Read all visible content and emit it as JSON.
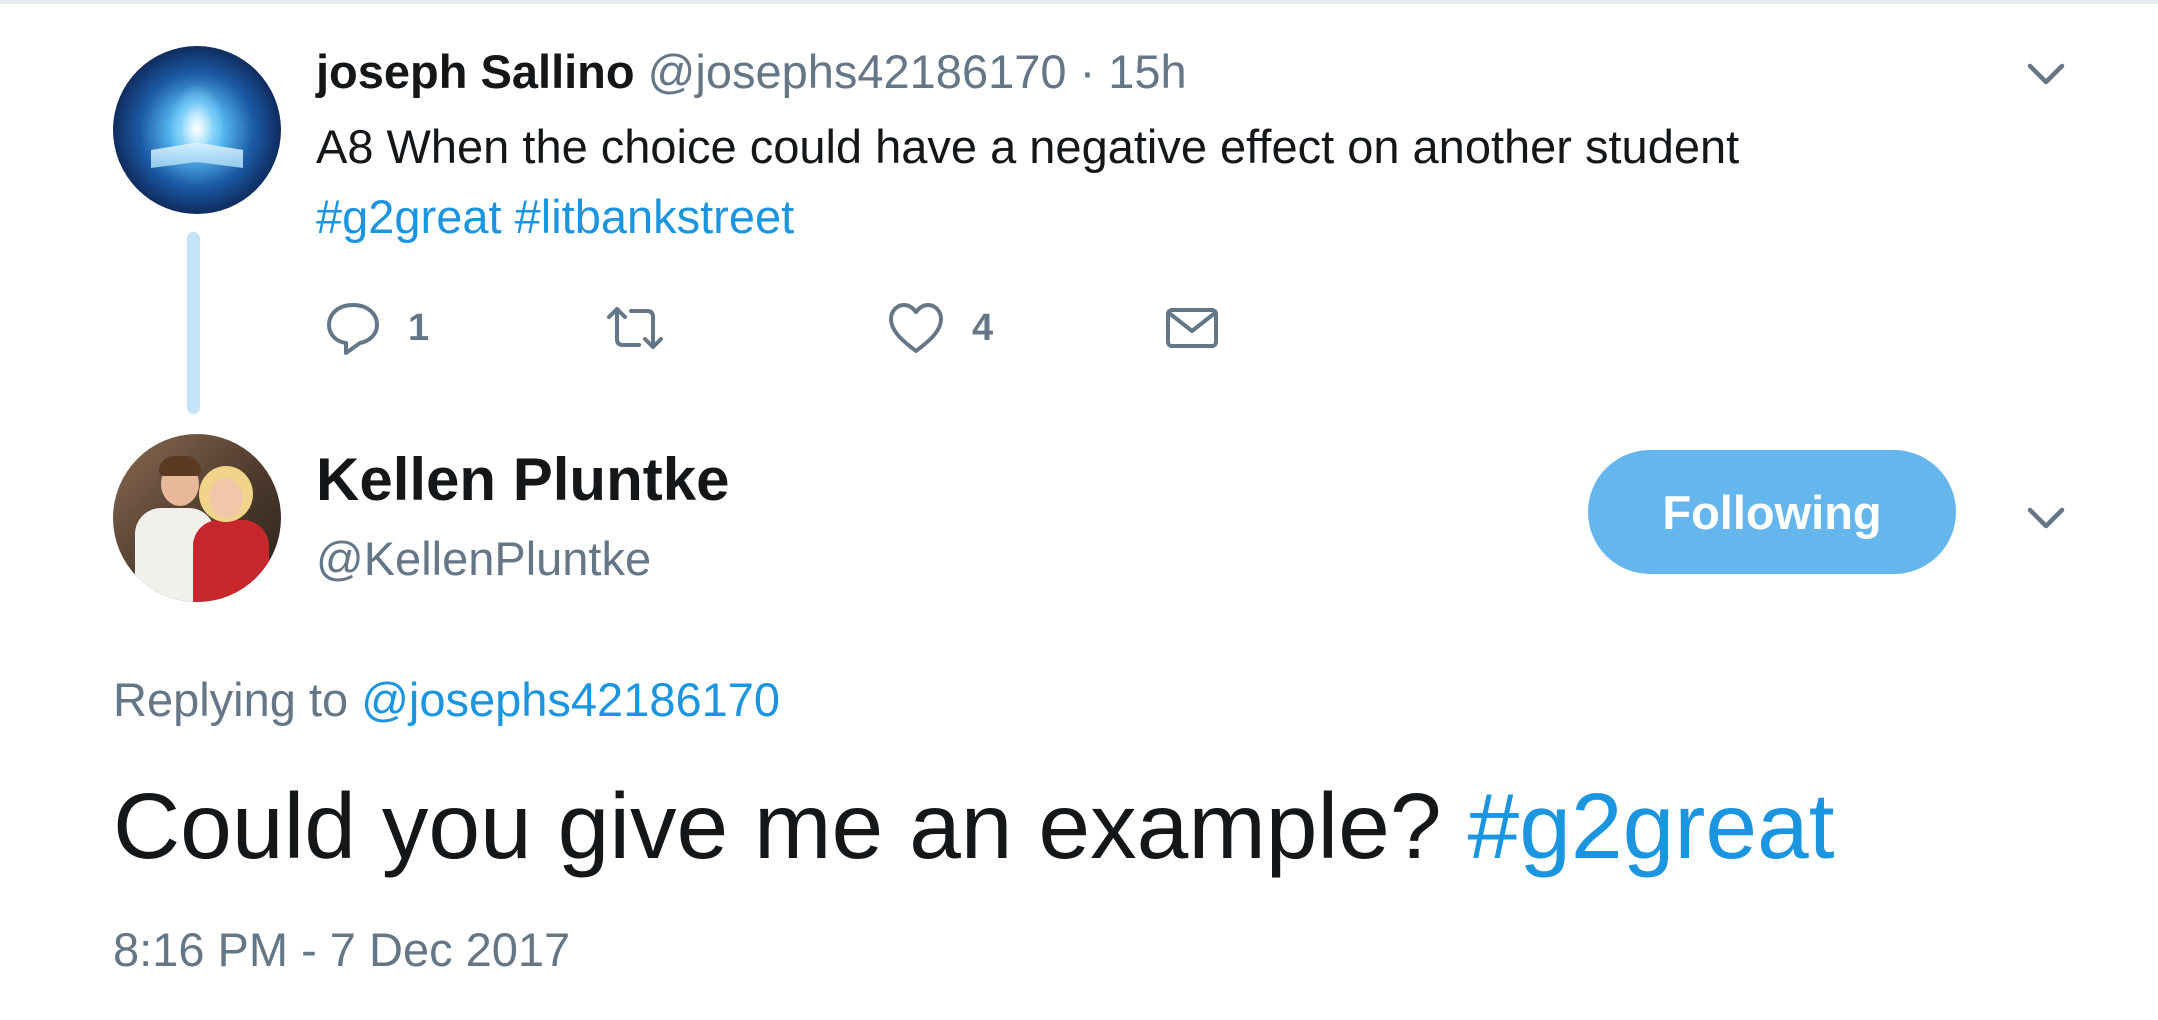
{
  "parent_tweet": {
    "author_name": "joseph Sallino",
    "author_handle": "@josephs42186170",
    "separator": "·",
    "time_ago": "15h",
    "text": "A8 When the choice could have a negative effect on another student",
    "hashtags": [
      "#g2great",
      "#litbankstreet"
    ],
    "actions": {
      "reply_count": "1",
      "retweet_count": "",
      "like_count": "4"
    }
  },
  "tweet": {
    "author_name": "Kellen Pluntke",
    "author_handle": "@KellenPluntke",
    "follow_label": "Following",
    "replying_prefix": "Replying to",
    "replying_handle": "@josephs42186170",
    "text": "Could you give me an example?",
    "hashtag": "#g2great",
    "timestamp": "8:16 PM - 7 Dec 2017"
  },
  "icons": {
    "menu": "chevron-down-icon",
    "reply": "reply-icon",
    "retweet": "retweet-icon",
    "like": "heart-icon",
    "dm": "envelope-icon"
  },
  "colors": {
    "link": "#1b95e0",
    "secondary_text": "#657786",
    "primary_text": "#14171a",
    "follow_button": "#66b6ee",
    "thread_line": "#c4e4fa"
  }
}
